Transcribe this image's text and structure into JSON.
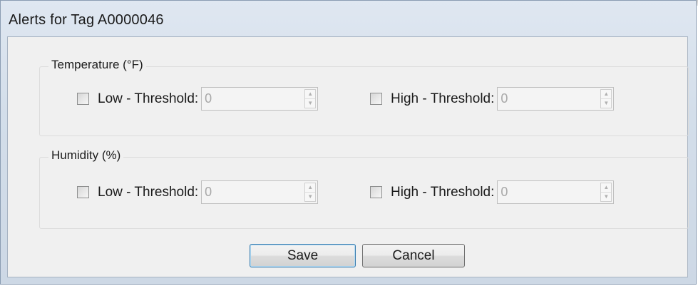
{
  "dialog": {
    "title": "Alerts for Tag A0000046"
  },
  "groups": [
    {
      "label": "Temperature (°F)",
      "low": {
        "label": "Low - Threshold:",
        "value": "0"
      },
      "high": {
        "label": "High - Threshold:",
        "value": "0"
      }
    },
    {
      "label": "Humidity (%)",
      "low": {
        "label": "Low - Threshold:",
        "value": "0"
      },
      "high": {
        "label": "High - Threshold:",
        "value": "0"
      }
    }
  ],
  "buttons": {
    "save": "Save",
    "cancel": "Cancel"
  },
  "icons": {
    "spin_up": "spin-up-arrow-icon",
    "spin_down": "spin-down-arrow-icon"
  }
}
